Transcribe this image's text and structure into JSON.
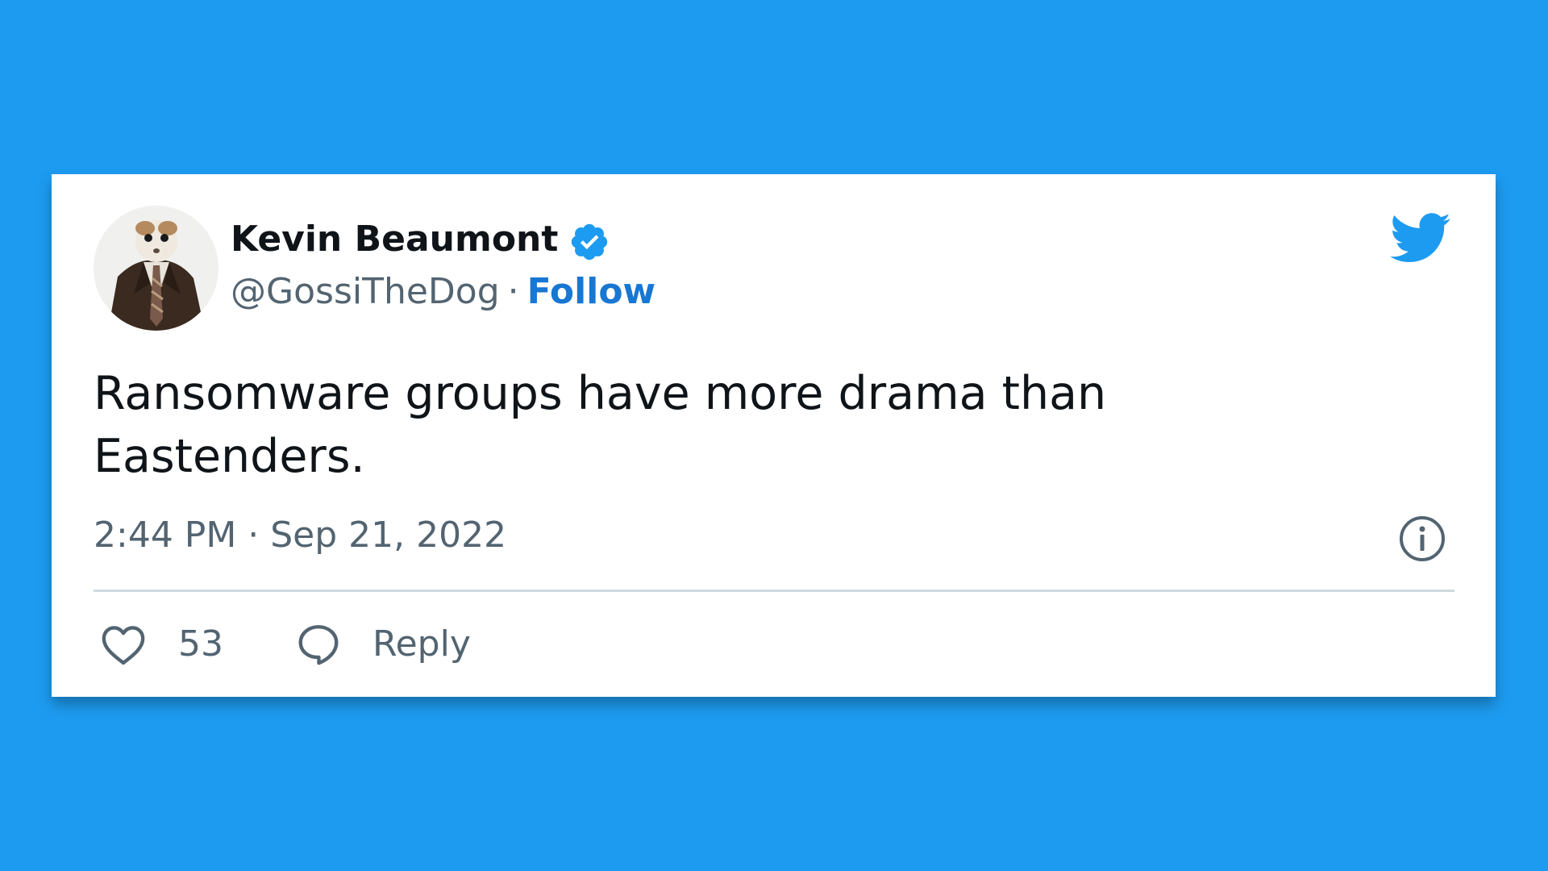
{
  "tweet": {
    "author": {
      "name": "Kevin Beaumont",
      "handle": "@GossiTheDog",
      "separator": "·",
      "follow_label": "Follow",
      "verified": true
    },
    "text": "Ransomware groups have more drama than Eastenders.",
    "timestamp": "2:44 PM · Sep 21, 2022",
    "actions": {
      "like_count": "53",
      "reply_label": "Reply"
    }
  },
  "icons": {
    "brand": "twitter-bird-icon",
    "verified": "verified-badge-icon",
    "info": "info-icon",
    "like": "heart-icon",
    "reply": "speech-bubble-icon"
  },
  "colors": {
    "background": "#1d9bf0",
    "card": "#ffffff",
    "accent_blue": "#1d9bf0",
    "follow_blue": "#1877d2",
    "text_primary": "#0f1419",
    "text_secondary": "#536471",
    "divider": "#cfd9de"
  }
}
